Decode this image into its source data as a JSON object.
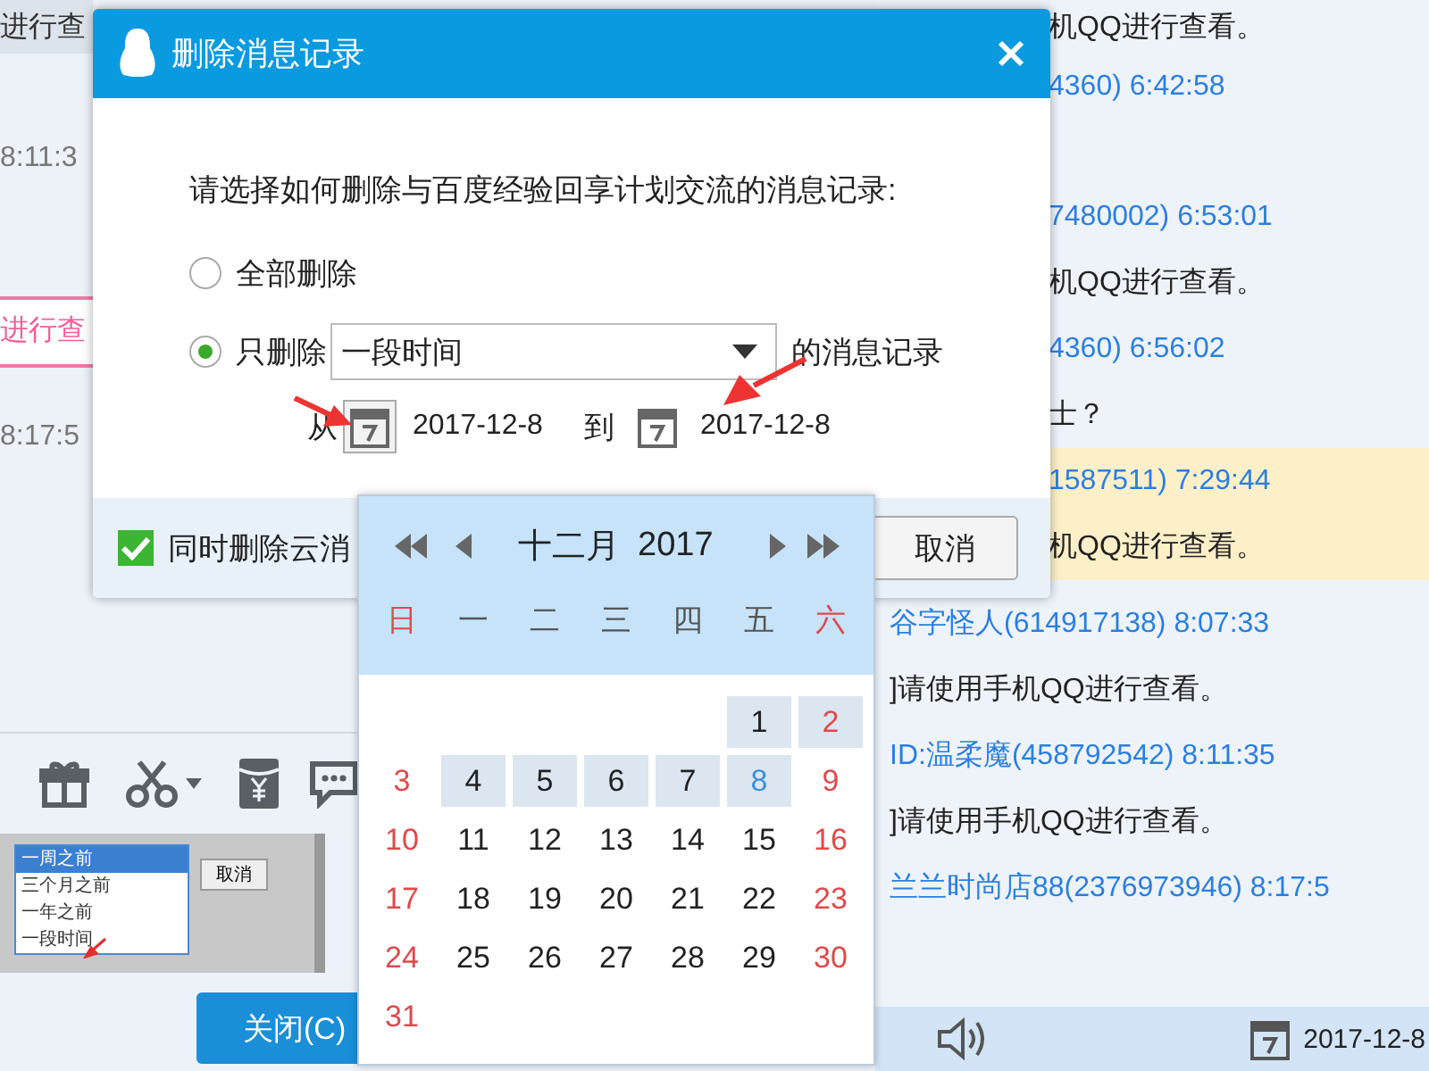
{
  "chat_left": {
    "messages": [
      {
        "kind": "banded",
        "text": "进行查"
      },
      {
        "kind": "time",
        "text": "8:11:3"
      },
      {
        "kind": "bubble",
        "text": "进行查"
      },
      {
        "kind": "time",
        "text": "8:17:5"
      }
    ]
  },
  "thumbnail": {
    "options": [
      {
        "label": "一周之前",
        "selected": true
      },
      {
        "label": "三个月之前",
        "selected": false
      },
      {
        "label": "一年之前",
        "selected": false
      },
      {
        "label": "一段时间",
        "selected": false
      }
    ],
    "cancel": "取消"
  },
  "close_button": "关闭(C)",
  "history": [
    {
      "kind": "text",
      "text": "机QQ进行查看。",
      "highlighted": false
    },
    {
      "kind": "name",
      "text": "4360) 6:42:58",
      "highlighted": false
    },
    {
      "kind": "name",
      "text": "7480002) 6:53:01",
      "highlighted": false
    },
    {
      "kind": "text",
      "text": "机QQ进行查看。",
      "highlighted": false
    },
    {
      "kind": "name",
      "text": "4360) 6:56:02",
      "highlighted": false
    },
    {
      "kind": "text",
      "text": "士？",
      "highlighted": false
    },
    {
      "kind": "name",
      "text": "1587511) 7:29:44",
      "highlighted": true
    },
    {
      "kind": "text",
      "text": "机QQ进行查看。",
      "highlighted": true
    },
    {
      "kind": "name",
      "text": "谷字怪人(614917138) 8:07:33",
      "highlighted": false
    },
    {
      "kind": "text",
      "text": "]请使用手机QQ进行查看。",
      "highlighted": false
    },
    {
      "kind": "name",
      "text": "ID:温柔魔(458792542) 8:11:35",
      "highlighted": false
    },
    {
      "kind": "text",
      "text": "]请使用手机QQ进行查看。",
      "highlighted": false
    },
    {
      "kind": "name",
      "text": "兰兰时尚店88(2376973946) 8:17:5",
      "highlighted": false
    }
  ],
  "bottom_bar": {
    "date": "2017-12-8"
  },
  "dialog": {
    "title": "删除消息记录",
    "prompt": "请选择如何删除与百度经验回享计划交流的消息记录:",
    "options": [
      {
        "label": "全部删除",
        "selected": false
      },
      {
        "label": "只删除",
        "selected": true
      }
    ],
    "range_select": {
      "value": "一段时间"
    },
    "range_suffix": "的消息记录",
    "from_label": "从",
    "from_date": "2017-12-8",
    "to_label": "到",
    "to_date": "2017-12-8",
    "cloud_checkbox": {
      "label": "同时删除云消",
      "checked": true
    },
    "cancel_button": "取消"
  },
  "calendar": {
    "month": "十二月",
    "year": "2017",
    "weekdays": [
      "日",
      "一",
      "二",
      "三",
      "四",
      "五",
      "六"
    ],
    "weeks": [
      [
        {
          "day": "1",
          "in_range": true,
          "today": false
        },
        {
          "day": "2",
          "in_range": true,
          "today": false
        }
      ],
      [
        {
          "day": "3",
          "in_range": false,
          "today": false
        },
        {
          "day": "4",
          "in_range": true,
          "today": false
        },
        {
          "day": "5",
          "in_range": true,
          "today": false
        },
        {
          "day": "6",
          "in_range": true,
          "today": false
        },
        {
          "day": "7",
          "in_range": true,
          "today": false
        },
        {
          "day": "8",
          "in_range": true,
          "today": true
        },
        {
          "day": "9",
          "in_range": false,
          "today": false
        }
      ],
      [
        {
          "day": "10",
          "in_range": false,
          "today": false
        },
        {
          "day": "11",
          "in_range": false,
          "today": false
        },
        {
          "day": "12",
          "in_range": false,
          "today": false
        },
        {
          "day": "13",
          "in_range": false,
          "today": false
        },
        {
          "day": "14",
          "in_range": false,
          "today": false
        },
        {
          "day": "15",
          "in_range": false,
          "today": false
        },
        {
          "day": "16",
          "in_range": false,
          "today": false
        }
      ],
      [
        {
          "day": "17",
          "in_range": false,
          "today": false
        },
        {
          "day": "18",
          "in_range": false,
          "today": false
        },
        {
          "day": "19",
          "in_range": false,
          "today": false
        },
        {
          "day": "20",
          "in_range": false,
          "today": false
        },
        {
          "day": "21",
          "in_range": false,
          "today": false
        },
        {
          "day": "22",
          "in_range": false,
          "today": false
        },
        {
          "day": "23",
          "in_range": false,
          "today": false
        }
      ],
      [
        {
          "day": "24",
          "in_range": false,
          "today": false
        },
        {
          "day": "25",
          "in_range": false,
          "today": false
        },
        {
          "day": "26",
          "in_range": false,
          "today": false
        },
        {
          "day": "27",
          "in_range": false,
          "today": false
        },
        {
          "day": "28",
          "in_range": false,
          "today": false
        },
        {
          "day": "29",
          "in_range": false,
          "today": false
        },
        {
          "day": "30",
          "in_range": false,
          "today": false
        }
      ],
      [
        {
          "day": "31",
          "in_range": false,
          "today": false
        }
      ]
    ]
  }
}
